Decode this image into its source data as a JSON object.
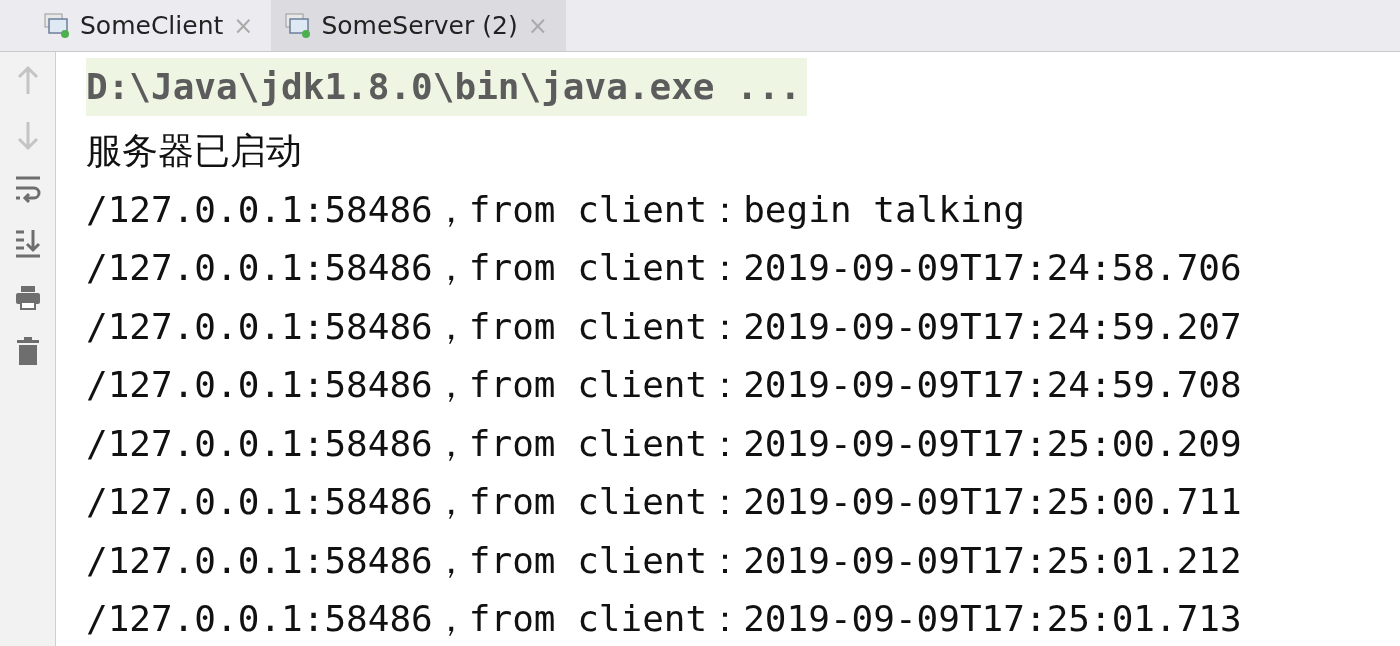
{
  "tabs": [
    {
      "label": "SomeClient",
      "selected": false,
      "close": "×"
    },
    {
      "label": "SomeServer (2)",
      "selected": true,
      "close": "×"
    }
  ],
  "toolbar": [
    {
      "kind": "up",
      "disabled": true
    },
    {
      "kind": "down",
      "disabled": true
    },
    {
      "kind": "wrap",
      "disabled": false
    },
    {
      "kind": "scroll-end",
      "disabled": false
    },
    {
      "kind": "print",
      "disabled": false
    },
    {
      "kind": "clear",
      "disabled": false
    }
  ],
  "console": {
    "command": "D:\\Java\\jdk1.8.0\\bin\\java.exe ...",
    "lines": [
      "服务器已启动",
      "/127.0.0.1:58486，from client：begin talking",
      "/127.0.0.1:58486，from client：2019-09-09T17:24:58.706",
      "/127.0.0.1:58486，from client：2019-09-09T17:24:59.207",
      "/127.0.0.1:58486，from client：2019-09-09T17:24:59.708",
      "/127.0.0.1:58486，from client：2019-09-09T17:25:00.209",
      "/127.0.0.1:58486，from client：2019-09-09T17:25:00.711",
      "/127.0.0.1:58486，from client：2019-09-09T17:25:01.212",
      "/127.0.0.1:58486，from client：2019-09-09T17:25:01.713"
    ]
  }
}
